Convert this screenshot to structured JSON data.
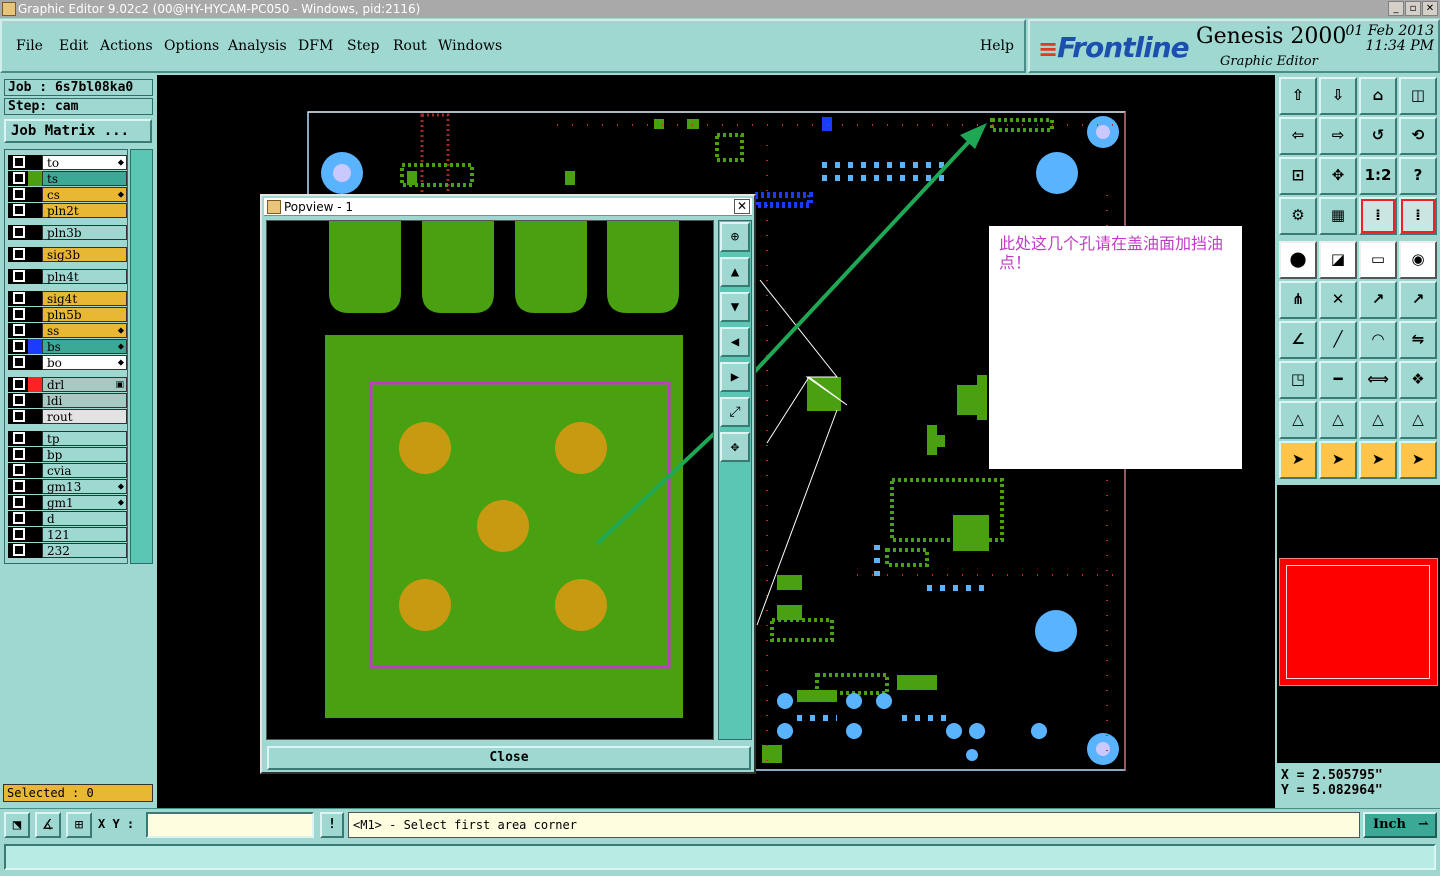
{
  "window": {
    "title": "Graphic Editor 9.02c2 (00@HY-HYCAM-PC050 - Windows, pid:2116)"
  },
  "menu": {
    "items": [
      "File",
      "Edit",
      "Actions",
      "Options",
      "Analysis",
      "DFM",
      "Step",
      "Rout",
      "Windows"
    ],
    "help": "Help"
  },
  "brand": {
    "logo": "Frontline",
    "product": "Genesis 2000",
    "subtitle": "Graphic Editor",
    "date": "01 Feb 2013",
    "time": "11:34 PM"
  },
  "job": {
    "job_label": "Job : 6s7bl08ka0",
    "step_label": "Step: cam",
    "matrix_button": "Job Matrix ..."
  },
  "layers": [
    {
      "name": "to",
      "color": "#ffffff",
      "swatch": "#000000",
      "mark": "⬥",
      "group": 0
    },
    {
      "name": "ts",
      "color": "#3ca896",
      "swatch": "#49a010",
      "mark": "",
      "group": 0
    },
    {
      "name": "cs",
      "color": "#e8b733",
      "swatch": "#000000",
      "mark": "⬥",
      "group": 0
    },
    {
      "name": "pln2t",
      "color": "#e8b733",
      "swatch": "#000000",
      "mark": "",
      "group": 0
    },
    {
      "name": "pln3b",
      "color": "#9ed8d0",
      "swatch": "#000000",
      "mark": "",
      "group": 1
    },
    {
      "name": "sig3b",
      "color": "#e8b733",
      "swatch": "#000000",
      "mark": "",
      "group": 2
    },
    {
      "name": "pln4t",
      "color": "#9ed8d0",
      "swatch": "#000000",
      "mark": "",
      "group": 3
    },
    {
      "name": "sig4t",
      "color": "#e8b733",
      "swatch": "#000000",
      "mark": "",
      "group": 4
    },
    {
      "name": "pln5b",
      "color": "#e8b733",
      "swatch": "#000000",
      "mark": "",
      "group": 4
    },
    {
      "name": "ss",
      "color": "#e8b733",
      "swatch": "#000000",
      "mark": "⬥",
      "group": 4
    },
    {
      "name": "bs",
      "color": "#3ca896",
      "swatch": "#1a3cff",
      "mark": "⬥",
      "group": 4
    },
    {
      "name": "bo",
      "color": "#ffffff",
      "swatch": "#000000",
      "mark": "⬥",
      "group": 4
    },
    {
      "name": "drl",
      "color": "#a6c9c4",
      "swatch": "#ff2222",
      "mark": "▣",
      "group": 5
    },
    {
      "name": "ldi",
      "color": "#a6c9c4",
      "swatch": "#000000",
      "mark": "",
      "group": 5
    },
    {
      "name": "rout",
      "color": "#e3e3e3",
      "swatch": "#000000",
      "mark": "",
      "group": 5
    },
    {
      "name": "tp",
      "color": "#9ed8d0",
      "swatch": "#000000",
      "mark": "",
      "group": 6
    },
    {
      "name": "bp",
      "color": "#9ed8d0",
      "swatch": "#000000",
      "mark": "",
      "group": 6
    },
    {
      "name": "cvia",
      "color": "#9ed8d0",
      "swatch": "#000000",
      "mark": "",
      "group": 6
    },
    {
      "name": "gm13",
      "color": "#9ed8d0",
      "swatch": "#000000",
      "mark": "⬥",
      "group": 6
    },
    {
      "name": "gm1",
      "color": "#9ed8d0",
      "swatch": "#000000",
      "mark": "⬥",
      "group": 6
    },
    {
      "name": "d",
      "color": "#9ed8d0",
      "swatch": "#000000",
      "mark": "",
      "group": 6
    },
    {
      "name": "121",
      "color": "#9ed8d0",
      "swatch": "#000000",
      "mark": "",
      "group": 6
    },
    {
      "name": "232",
      "color": "#9ed8d0",
      "swatch": "#000000",
      "mark": "",
      "group": 6
    }
  ],
  "selection": {
    "label": "Selected : 0"
  },
  "popview": {
    "title": "Popview - 1",
    "close_label": "Close"
  },
  "annotation": {
    "text": "此处这几个孔请在盖油面加挡油点！"
  },
  "coords": {
    "x": "X = 2.505795\"",
    "y": "Y = 5.082964\""
  },
  "status": {
    "xy_label": "X Y :",
    "xy_value": "",
    "pause_label": "!",
    "prompt": "<M1> - Select first area corner",
    "unit": "Inch"
  },
  "toolbar": {
    "zoom_11_label": "1:2",
    "help_label": "?"
  },
  "colors": {
    "accent": "#9ed8d0",
    "board_green": "#49a010",
    "pad_orange": "#c89a12",
    "via_blue": "#5ab3ff",
    "highlight": "#c03cc8"
  }
}
